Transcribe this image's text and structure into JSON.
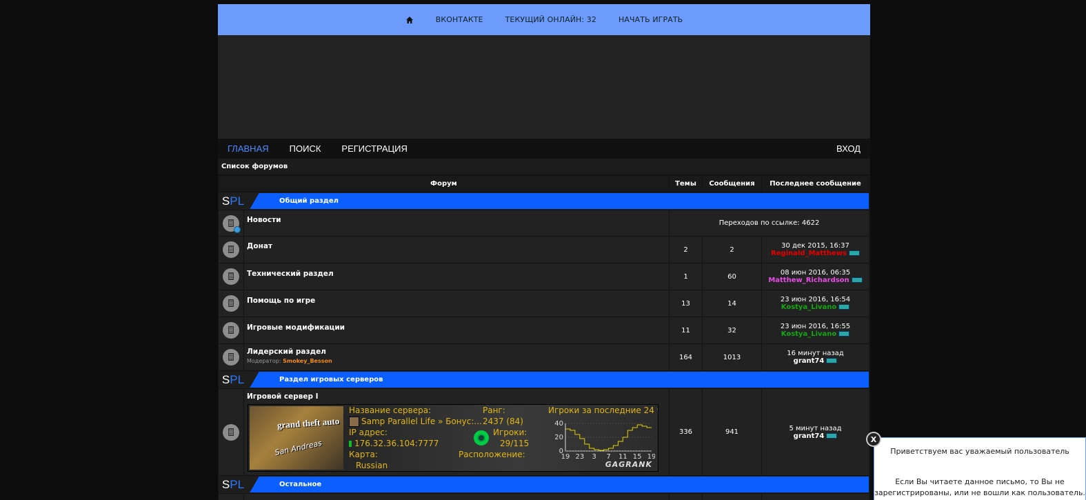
{
  "topbar": {
    "home_icon": "home-icon",
    "links": [
      "ВКОНТАКТЕ",
      "ТЕКУЩИЙ ОНЛАЙН: 32",
      "НАЧАТЬ ИГРАТЬ"
    ]
  },
  "nav": {
    "items": [
      "ГЛАВНАЯ",
      "ПОИСК",
      "РЕГИСТРАЦИЯ"
    ],
    "active": "ГЛАВНАЯ",
    "login": "ВХОД"
  },
  "breadcrumb": "Список форумов",
  "table": {
    "headers": [
      "Форум",
      "Темы",
      "Сообщения",
      "Последнее сообщение"
    ]
  },
  "brand": {
    "s": "S",
    "pl": "PL"
  },
  "categories": [
    {
      "title": "Общий раздел",
      "forums": [
        {
          "name": "Новости",
          "redirect": "Переходов по ссылке: 4622"
        },
        {
          "name": "Донат",
          "topics": "2",
          "posts": "2",
          "last_date": "30 дек 2015, 16:37",
          "last_user": "Reginald_Matthews",
          "user_color": "#e60000"
        },
        {
          "name": "Технический раздел",
          "topics": "1",
          "posts": "60",
          "last_date": "08 июн 2016, 06:35",
          "last_user": "Matthew_Richardson",
          "user_color": "#e84ce6"
        },
        {
          "name": "Помощь по игре",
          "topics": "13",
          "posts": "14",
          "last_date": "23 июн 2016, 16:54",
          "last_user": "Kostya_Livano",
          "user_color": "#14a814"
        },
        {
          "name": "Игровые модификации",
          "topics": "11",
          "posts": "32",
          "last_date": "23 июн 2016, 16:55",
          "last_user": "Kostya_Livano",
          "user_color": "#14a814"
        },
        {
          "name": "Лидерский раздел",
          "moderator_label": "Модератор:",
          "moderator": "Smokey_Besson",
          "topics": "164",
          "posts": "1013",
          "last_date": "16 минут назад",
          "last_user": "grant74",
          "user_color": "#ffffff"
        }
      ]
    },
    {
      "title": "Раздел игровых серверов",
      "forums": [
        {
          "name": "Игровой сервер I",
          "topics": "336",
          "posts": "941",
          "last_date": "5 минут назад",
          "last_user": "grant74",
          "user_color": "#ffffff",
          "server": {
            "logo_text": "grand theft auto",
            "logo_sub": "San Andreas",
            "name_label": "Название сервера:",
            "name_value": "Samp Parallel Life » Бонус:...",
            "ip_label": "IP адрес:",
            "ip_value": "176.32.36.104:7777",
            "map_label": "Карта:",
            "map_value": "Russian",
            "rank_label": "Ранг:",
            "rank_value": "2437 (84)",
            "players_label": "Игроки:",
            "players_value": "29/115",
            "location_label": "Расположение:",
            "graph_label": "Игроки за последние 24 ч:",
            "graph_y_ticks": [
              "40",
              "20",
              "0"
            ],
            "graph_x_ticks": [
              "19",
              "23",
              "3",
              "7",
              "11",
              "15",
              "19"
            ],
            "brand": "GAGRANK"
          }
        }
      ]
    },
    {
      "title": "Остальное",
      "forums": []
    }
  ],
  "chart_data": {
    "type": "line",
    "title": "Игроки за последние 24 ч:",
    "x": [
      "19",
      "23",
      "3",
      "7",
      "11",
      "15",
      "19"
    ],
    "ylim": [
      0,
      40
    ],
    "series": [
      {
        "values": [
          32,
          30,
          24,
          18,
          10,
          4,
          2,
          1,
          2,
          4,
          8,
          14,
          20,
          30,
          34,
          38,
          36,
          34
        ]
      }
    ]
  },
  "popup": {
    "close": "X",
    "title": "Приветствуем вас уважаемый пользователь",
    "body_line1": "Если Вы читаете данное письмо, то Вы не",
    "body_line2": "зарегистрированы, или не вошли как пользователь."
  }
}
